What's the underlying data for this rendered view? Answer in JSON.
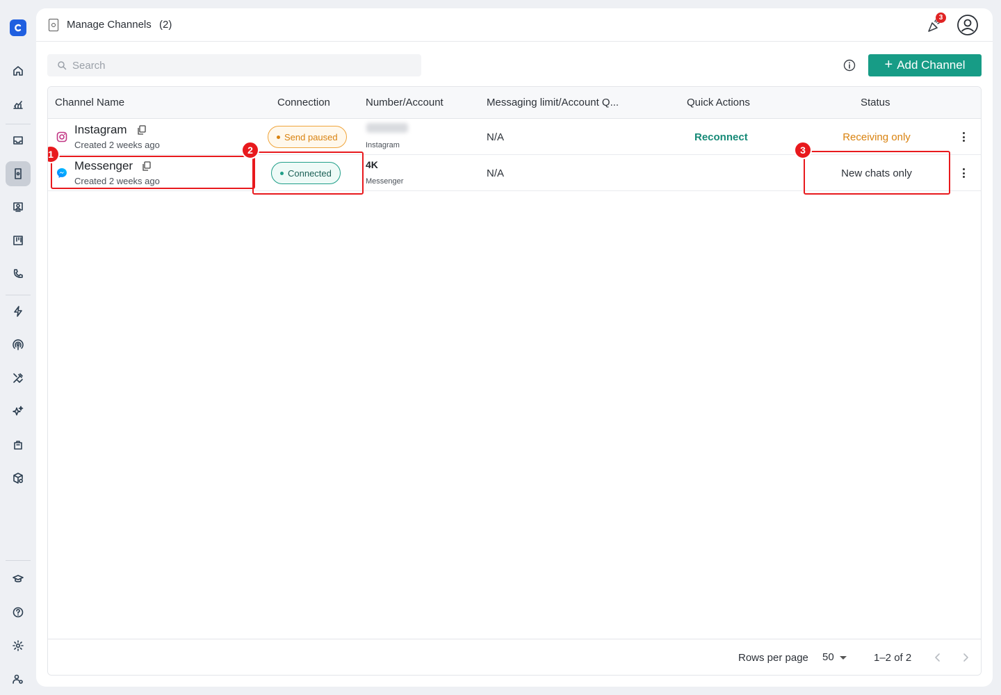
{
  "header": {
    "title": "Manage Channels",
    "count": "(2)",
    "notification_count": "3"
  },
  "toolbar": {
    "search_placeholder": "Search",
    "add_label": "Add Channel"
  },
  "table": {
    "columns": [
      "Channel Name",
      "Connection",
      "Number/Account",
      "Messaging limit/Account Q...",
      "Quick Actions",
      "Status"
    ],
    "rows": [
      {
        "name": "Instagram",
        "created": "Created 2 weeks ago",
        "connection": "Send paused",
        "account_main": "",
        "account_sub": "Instagram",
        "limit": "N/A",
        "quick_action": "Reconnect",
        "status": "Receiving only",
        "status_color": "#d9820f",
        "icon": "instagram-icon"
      },
      {
        "name": "Messenger",
        "created": "Created 2 weeks ago",
        "connection": "Connected",
        "account_main": "4K",
        "account_sub": "Messenger",
        "limit": "N/A",
        "quick_action": "",
        "status": "New chats only",
        "status_color": "#2c3138",
        "icon": "messenger-icon"
      }
    ]
  },
  "annotations": [
    "1",
    "2",
    "3"
  ],
  "footer": {
    "rows_per_page_label": "Rows per page",
    "rows_per_page_value": "50",
    "range": "1–2 of 2"
  },
  "colors": {
    "accent": "#179c86",
    "brand": "#1f5fe0",
    "annotation": "#e8191d"
  }
}
